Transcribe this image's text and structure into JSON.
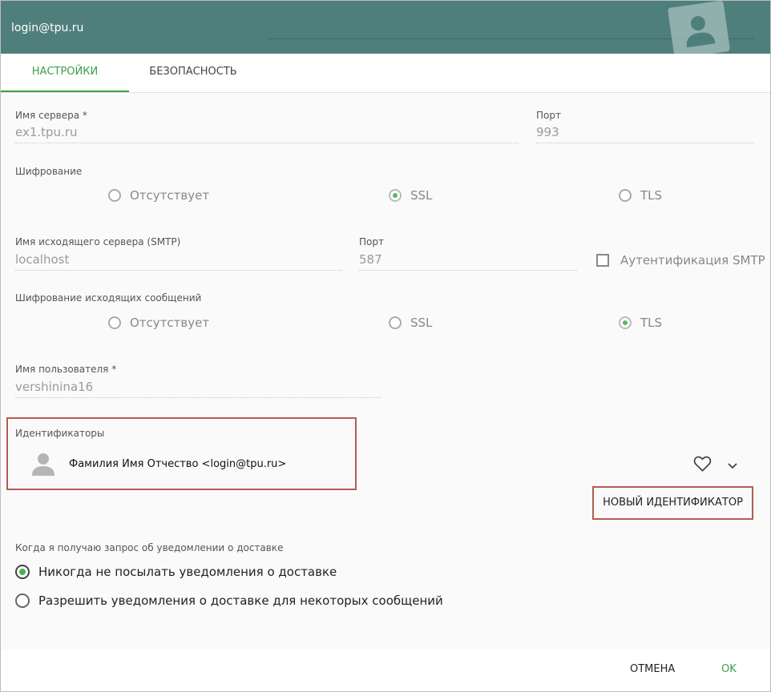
{
  "header": {
    "title": "login@tpu.ru"
  },
  "tabs": [
    {
      "label": "НАСТРОЙКИ",
      "active": true
    },
    {
      "label": "БЕЗОПАСНОСТЬ",
      "active": false
    }
  ],
  "incoming": {
    "server_label": "Имя сервера *",
    "server_value": "ex1.tpu.ru",
    "port_label": "Порт",
    "port_value": "993",
    "encryption_label": "Шифрование",
    "encryption_options": [
      "Отсутствует",
      "SSL",
      "TLS"
    ],
    "encryption_selected": "SSL"
  },
  "outgoing": {
    "server_label": "Имя исходящего сервера (SMTP)",
    "server_value": "localhost",
    "port_label": "Порт",
    "port_value": "587",
    "auth_label": "Аутентификация SMTP",
    "auth_checked": false,
    "encryption_label": "Шифрование исходящих сообщений",
    "encryption_options": [
      "Отсутствует",
      "SSL",
      "TLS"
    ],
    "encryption_selected": "TLS"
  },
  "user": {
    "label": "Имя пользователя *",
    "value": "vershinina16"
  },
  "identities": {
    "label": "Идентификаторы",
    "items": [
      {
        "display": "Фамилия Имя Отчество <login@tpu.ru>",
        "icon": "person-icon"
      }
    ],
    "new_button": "НОВЫЙ ИДЕНТИФИКАТОР"
  },
  "receipts": {
    "label": "Когда я получаю запрос об уведомлении о доставке",
    "options": [
      "Никогда не посылать уведомления о доставке",
      "Разрешить уведомления о доставке для некоторых сообщений"
    ],
    "selected": 0
  },
  "footer": {
    "cancel": "ОТМЕНА",
    "ok": "OK"
  },
  "colors": {
    "header": "#4f7f7d",
    "accent": "#3aa047",
    "highlight": "#b35c52"
  }
}
